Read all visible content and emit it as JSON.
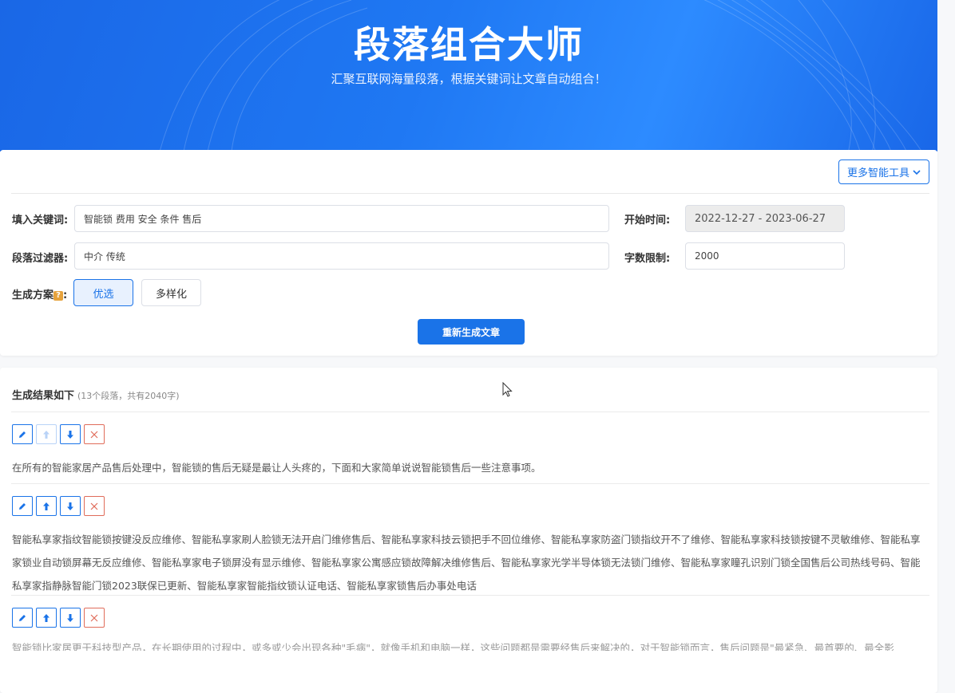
{
  "banner": {
    "title": "段落组合大师",
    "subtitle": "汇聚互联网海量段落，根据关键词让文章自动组合！"
  },
  "toolbar": {
    "more_tools_label": "更多智能工具"
  },
  "form": {
    "keywords_label": "填入关键词:",
    "keywords_value": "智能锁 费用 安全 条件 售后",
    "start_time_label": "开始时间:",
    "start_time_value": "2022-12-27 - 2023-06-27",
    "filter_label": "段落过滤器:",
    "filter_value": "中介 传统",
    "word_limit_label": "字数限制:",
    "word_limit_value": "2000",
    "scheme_label": "生成方案",
    "scheme_help": "?",
    "scheme_colon": ":",
    "scheme_options": [
      "优选",
      "多样化"
    ],
    "scheme_selected": "优选",
    "regenerate_label": "重新生成文章"
  },
  "result": {
    "title": "生成结果如下",
    "summary": "(13个段落，共有2040字)",
    "paragraphs": [
      {
        "text": "在所有的智能家居产品售后处理中，智能锁的售后无疑是最让人头疼的，下面和大家简单说说智能锁售后一些注意事项。"
      },
      {
        "text": "智能私享家指纹智能锁按键没反应维修、智能私享家刷人脸锁无法开启门维修售后、智能私享家科技云锁把手不回位维修、智能私享家防盗门锁指纹开不了维修、智能私享家科技锁按键不灵敏维修、智能私享家锁业自动锁屏幕无反应维修、智能私享家电子锁屏没有显示维修、智能私享家公寓感应锁故障解决维修售后、智能私享家光学半导体锁无法锁门维修、智能私享家瞳孔识别门锁全国售后公司热线号码、智能私享家指静脉智能门锁2023联保已更新、智能私享家智能指纹锁认证电话、智能私享家锁售后办事处电话"
      },
      {
        "text": "智能锁比家居更于科技型产品，在长期使用的过程中，或多或少会出现各种\"毛病\"，就像手机和电脑一样，这些问题都是需要经售后来解决的，对于智能锁而言，售后问题是\"最紧急、最首要的、最全影"
      }
    ]
  },
  "colors": {
    "primary": "#1a73e8",
    "danger": "#e06c5a",
    "banner_start": "#1a67e6",
    "banner_end": "#2d8bff"
  },
  "icons": {
    "edit": "pencil-icon",
    "move_up": "arrow-up-icon",
    "move_down": "arrow-down-icon",
    "delete": "close-icon",
    "dropdown": "chevron-down-icon",
    "help": "question-icon"
  }
}
